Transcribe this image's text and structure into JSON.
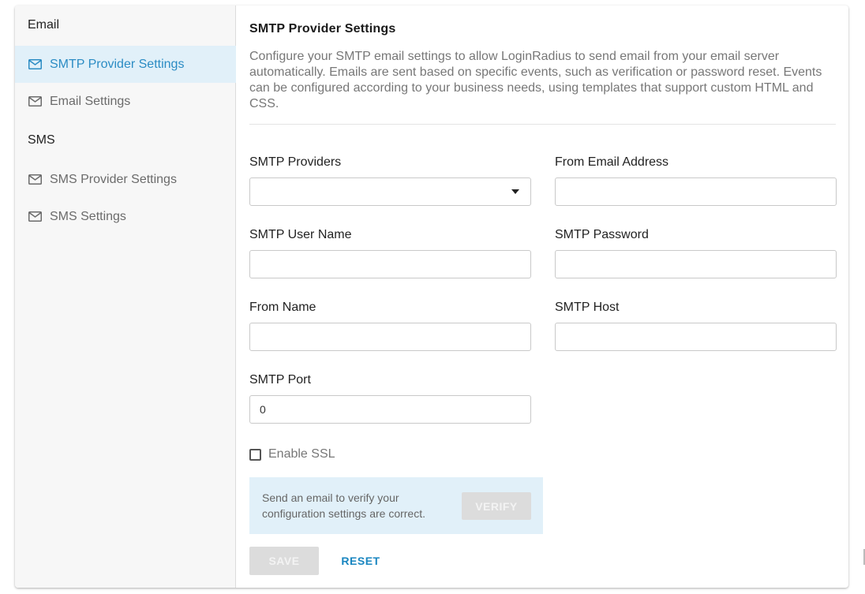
{
  "sidebar": {
    "email_heading": "Email",
    "sms_heading": "SMS",
    "items": [
      {
        "label": "SMTP Provider Settings",
        "icon": "mail-icon",
        "active": true
      },
      {
        "label": "Email Settings",
        "icon": "mail-icon",
        "active": false
      },
      {
        "label": "SMS Provider Settings",
        "icon": "mail-icon",
        "active": false
      },
      {
        "label": "SMS Settings",
        "icon": "mail-icon",
        "active": false
      }
    ]
  },
  "main": {
    "title": "SMTP Provider Settings",
    "description": "Configure your SMTP email settings to allow LoginRadius to send email from your email server automatically. Emails are sent based on specific events, such as verification or password reset. Events can be configured according to your business needs, using templates that support custom HTML and CSS."
  },
  "form": {
    "smtp_providers": {
      "label": "SMTP Providers",
      "value": ""
    },
    "from_email": {
      "label": "From Email Address",
      "value": ""
    },
    "smtp_username": {
      "label": "SMTP User Name",
      "value": ""
    },
    "smtp_password": {
      "label": "SMTP Password",
      "value": ""
    },
    "from_name": {
      "label": "From Name",
      "value": ""
    },
    "smtp_host": {
      "label": "SMTP Host",
      "value": ""
    },
    "smtp_port": {
      "label": "SMTP Port",
      "value": "0"
    },
    "enable_ssl": {
      "label": "Enable SSL",
      "checked": false
    }
  },
  "verify": {
    "text": "Send an email to verify your configuration settings are correct.",
    "button_label": "VERIFY"
  },
  "actions": {
    "save_label": "SAVE",
    "reset_label": "RESET"
  },
  "colors": {
    "accent": "#2b8cc4",
    "active_bg": "#e1f0f9",
    "disabled_button": "#dcdcdc"
  }
}
